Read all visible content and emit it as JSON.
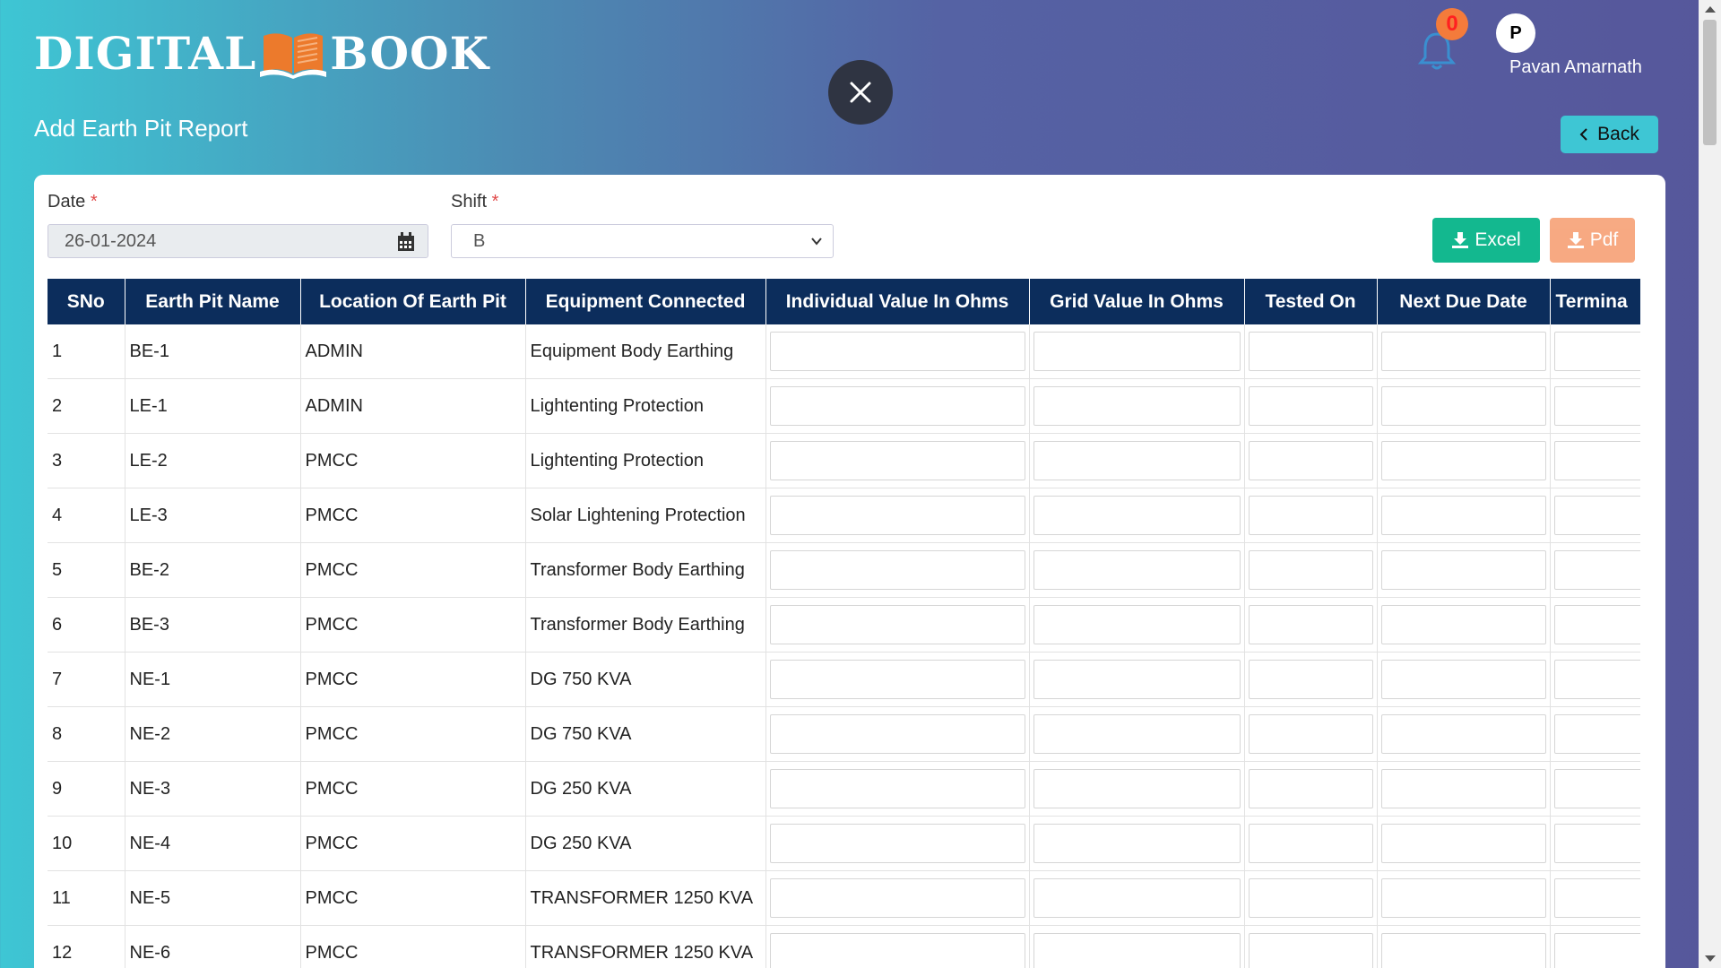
{
  "brand": {
    "left": "DIGITAL",
    "right": "BOOK"
  },
  "page_title": "Add Earth Pit Report",
  "notifications": {
    "count": "0"
  },
  "user": {
    "initial": "P",
    "name": "Pavan Amarnath"
  },
  "back_label": "Back",
  "form": {
    "date_label": "Date",
    "date_value": "26-01-2024",
    "shift_label": "Shift",
    "shift_value": "B",
    "required_mark": "*"
  },
  "export": {
    "excel_label": "Excel",
    "pdf_label": "Pdf"
  },
  "colors": {
    "header_bg": "#0c2d5c",
    "excel": "#13b88f",
    "pdf": "#f7a57c",
    "back": "#3ec6d4"
  },
  "table": {
    "headers": [
      "SNo",
      "Earth Pit Name",
      "Location Of Earth Pit",
      "Equipment Connected",
      "Individual Value In Ohms",
      "Grid Value In Ohms",
      "Tested On",
      "Next Due Date",
      "Termina"
    ],
    "rows": [
      {
        "sno": "1",
        "name": "BE-1",
        "location": "ADMIN",
        "equipment": "Equipment Body Earthing"
      },
      {
        "sno": "2",
        "name": "LE-1",
        "location": "ADMIN",
        "equipment": "Lightenting Protection"
      },
      {
        "sno": "3",
        "name": "LE-2",
        "location": "PMCC",
        "equipment": "Lightenting Protection"
      },
      {
        "sno": "4",
        "name": "LE-3",
        "location": "PMCC",
        "equipment": "Solar Lightening Protection"
      },
      {
        "sno": "5",
        "name": "BE-2",
        "location": "PMCC",
        "equipment": "Transformer Body Earthing"
      },
      {
        "sno": "6",
        "name": "BE-3",
        "location": "PMCC",
        "equipment": "Transformer Body Earthing"
      },
      {
        "sno": "7",
        "name": "NE-1",
        "location": "PMCC",
        "equipment": "DG 750 KVA"
      },
      {
        "sno": "8",
        "name": "NE-2",
        "location": "PMCC",
        "equipment": "DG 750 KVA"
      },
      {
        "sno": "9",
        "name": "NE-3",
        "location": "PMCC",
        "equipment": "DG 250 KVA"
      },
      {
        "sno": "10",
        "name": "NE-4",
        "location": "PMCC",
        "equipment": "DG 250 KVA"
      },
      {
        "sno": "11",
        "name": "NE-5",
        "location": "PMCC",
        "equipment": "TRANSFORMER 1250 KVA"
      },
      {
        "sno": "12",
        "name": "NE-6",
        "location": "PMCC",
        "equipment": "TRANSFORMER 1250 KVA"
      }
    ]
  }
}
